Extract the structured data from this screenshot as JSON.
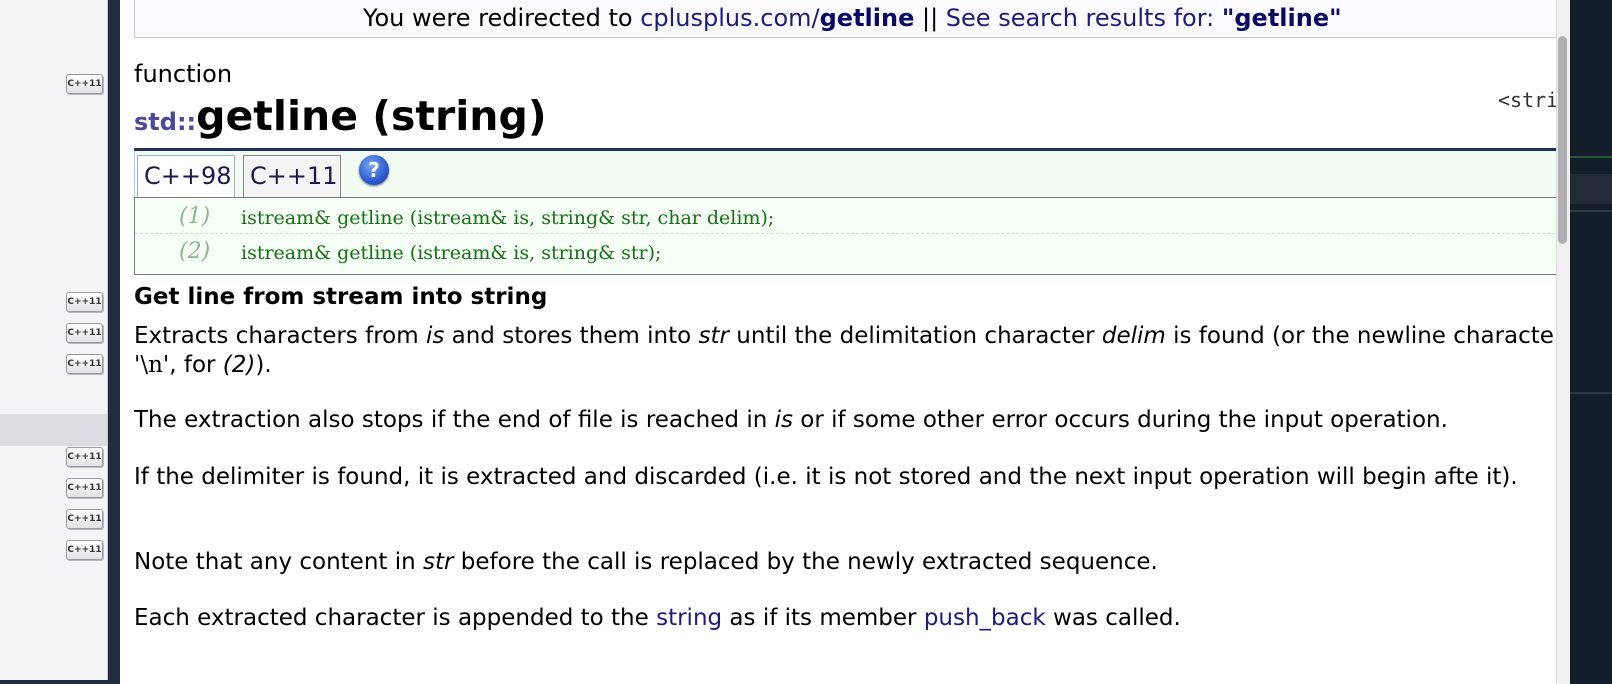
{
  "redirect": {
    "prefix": "You were redirected to ",
    "link_host": "cplusplus.com/",
    "link_bold": "getline",
    "separator": " || ",
    "search_label": "See search results for: ",
    "search_term": "\"getline\""
  },
  "header": {
    "category": "function",
    "namespace": "std::",
    "title": "getline (string)",
    "header_ref": "<stri"
  },
  "tabs": [
    {
      "label": "C++98",
      "active": true
    },
    {
      "label": "C++11",
      "active": false
    }
  ],
  "help_icon": "?",
  "prototypes": [
    {
      "num": "(1)",
      "code": "istream& getline (istream& is, string& str, char delim);"
    },
    {
      "num": "(2)",
      "code": "istream& getline (istream& is, string& str);"
    }
  ],
  "description": {
    "heading": "Get line from stream into string",
    "p1": {
      "t1": "Extracts characters from ",
      "e1": "is",
      "t2": " and stores them into ",
      "e2": "str",
      "t3": " until the delimitation character ",
      "e3": "delim",
      "t4": " is found (or the newline character, ",
      "code": "'\\n'",
      "t5": ", for ",
      "e4": "(2)",
      "t6": ")."
    },
    "p2": {
      "t1": "The extraction also stops if the end of file is reached in ",
      "e1": "is",
      "t2": " or if some other error occurs during the input operation."
    },
    "p3": "If the delimiter is found, it is extracted and discarded (i.e. it is not stored and the next input operation will begin afte it).",
    "p4": {
      "t1": "Note that any content in ",
      "e1": "str",
      "t2": " before the call is replaced by the newly extracted sequence."
    },
    "p5": {
      "t1": "Each extracted character is appended to the ",
      "link1": "string",
      "t2": " as if its member ",
      "link2": "push_back",
      "t3": " was called."
    }
  },
  "sidebar": {
    "badge_label": "C++11"
  },
  "colors": {
    "link": "#1c1c7a",
    "namespace": "#4a4a98",
    "title_rule": "#1f3358",
    "code_green": "#157015",
    "proto_bg": "#f6fff6"
  }
}
